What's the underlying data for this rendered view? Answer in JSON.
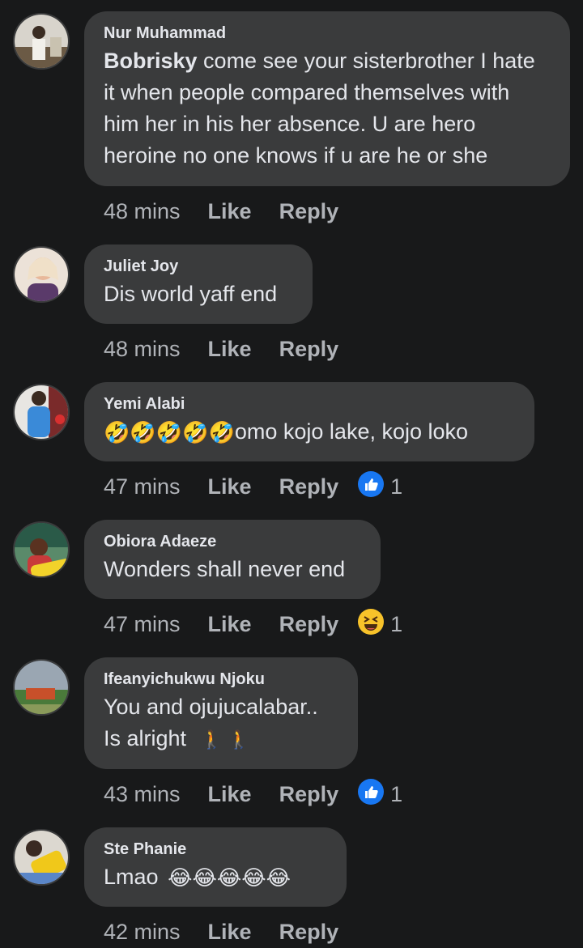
{
  "comments": [
    {
      "name": "Nur Muhammad",
      "mention": "Bobrisky",
      "text": " come see your sisterbrother I hate it when people compared themselves with him her in his her absence. U are hero heroine no one knows if u are he or she",
      "time": "48 mins",
      "like": "Like",
      "reply": "Reply",
      "avatar_icon": "user-avatar-photo"
    },
    {
      "name": "Juliet Joy",
      "text": "Dis world yaff end",
      "time": "48 mins",
      "like": "Like",
      "reply": "Reply",
      "avatar_icon": "user-avatar-photo"
    },
    {
      "name": "Yemi Alabi",
      "emoji": "🤣🤣🤣🤣🤣",
      "text": "omo kojo lake, kojo loko",
      "time": "47 mins",
      "like": "Like",
      "reply": "Reply",
      "reaction_icon": "like-reaction-icon",
      "reaction_count": "1"
    },
    {
      "name": "Obiora Adaeze",
      "text": "Wonders shall never end",
      "time": "47 mins",
      "like": "Like",
      "reply": "Reply",
      "reaction_icon": "haha-reaction-icon",
      "reaction_count": "1"
    },
    {
      "name": "Ifeanyichukwu Njoku",
      "text": "You and ojujucalabar..",
      "text2": "Is alright",
      "emoji2": "🚶 🚶",
      "time": "43 mins",
      "like": "Like",
      "reply": "Reply",
      "reaction_icon": "like-reaction-icon",
      "reaction_count": "1"
    },
    {
      "name": "Ste Phanie",
      "text": "Lmao",
      "emoji": "😂😂😂😂😂",
      "time": "42 mins",
      "like": "Like",
      "reply": "Reply"
    }
  ],
  "colors": {
    "background": "#18191a",
    "bubble": "#3a3b3c",
    "text": "#e4e6eb",
    "meta": "#b0b3b8",
    "like_blue": "#1877f2"
  }
}
